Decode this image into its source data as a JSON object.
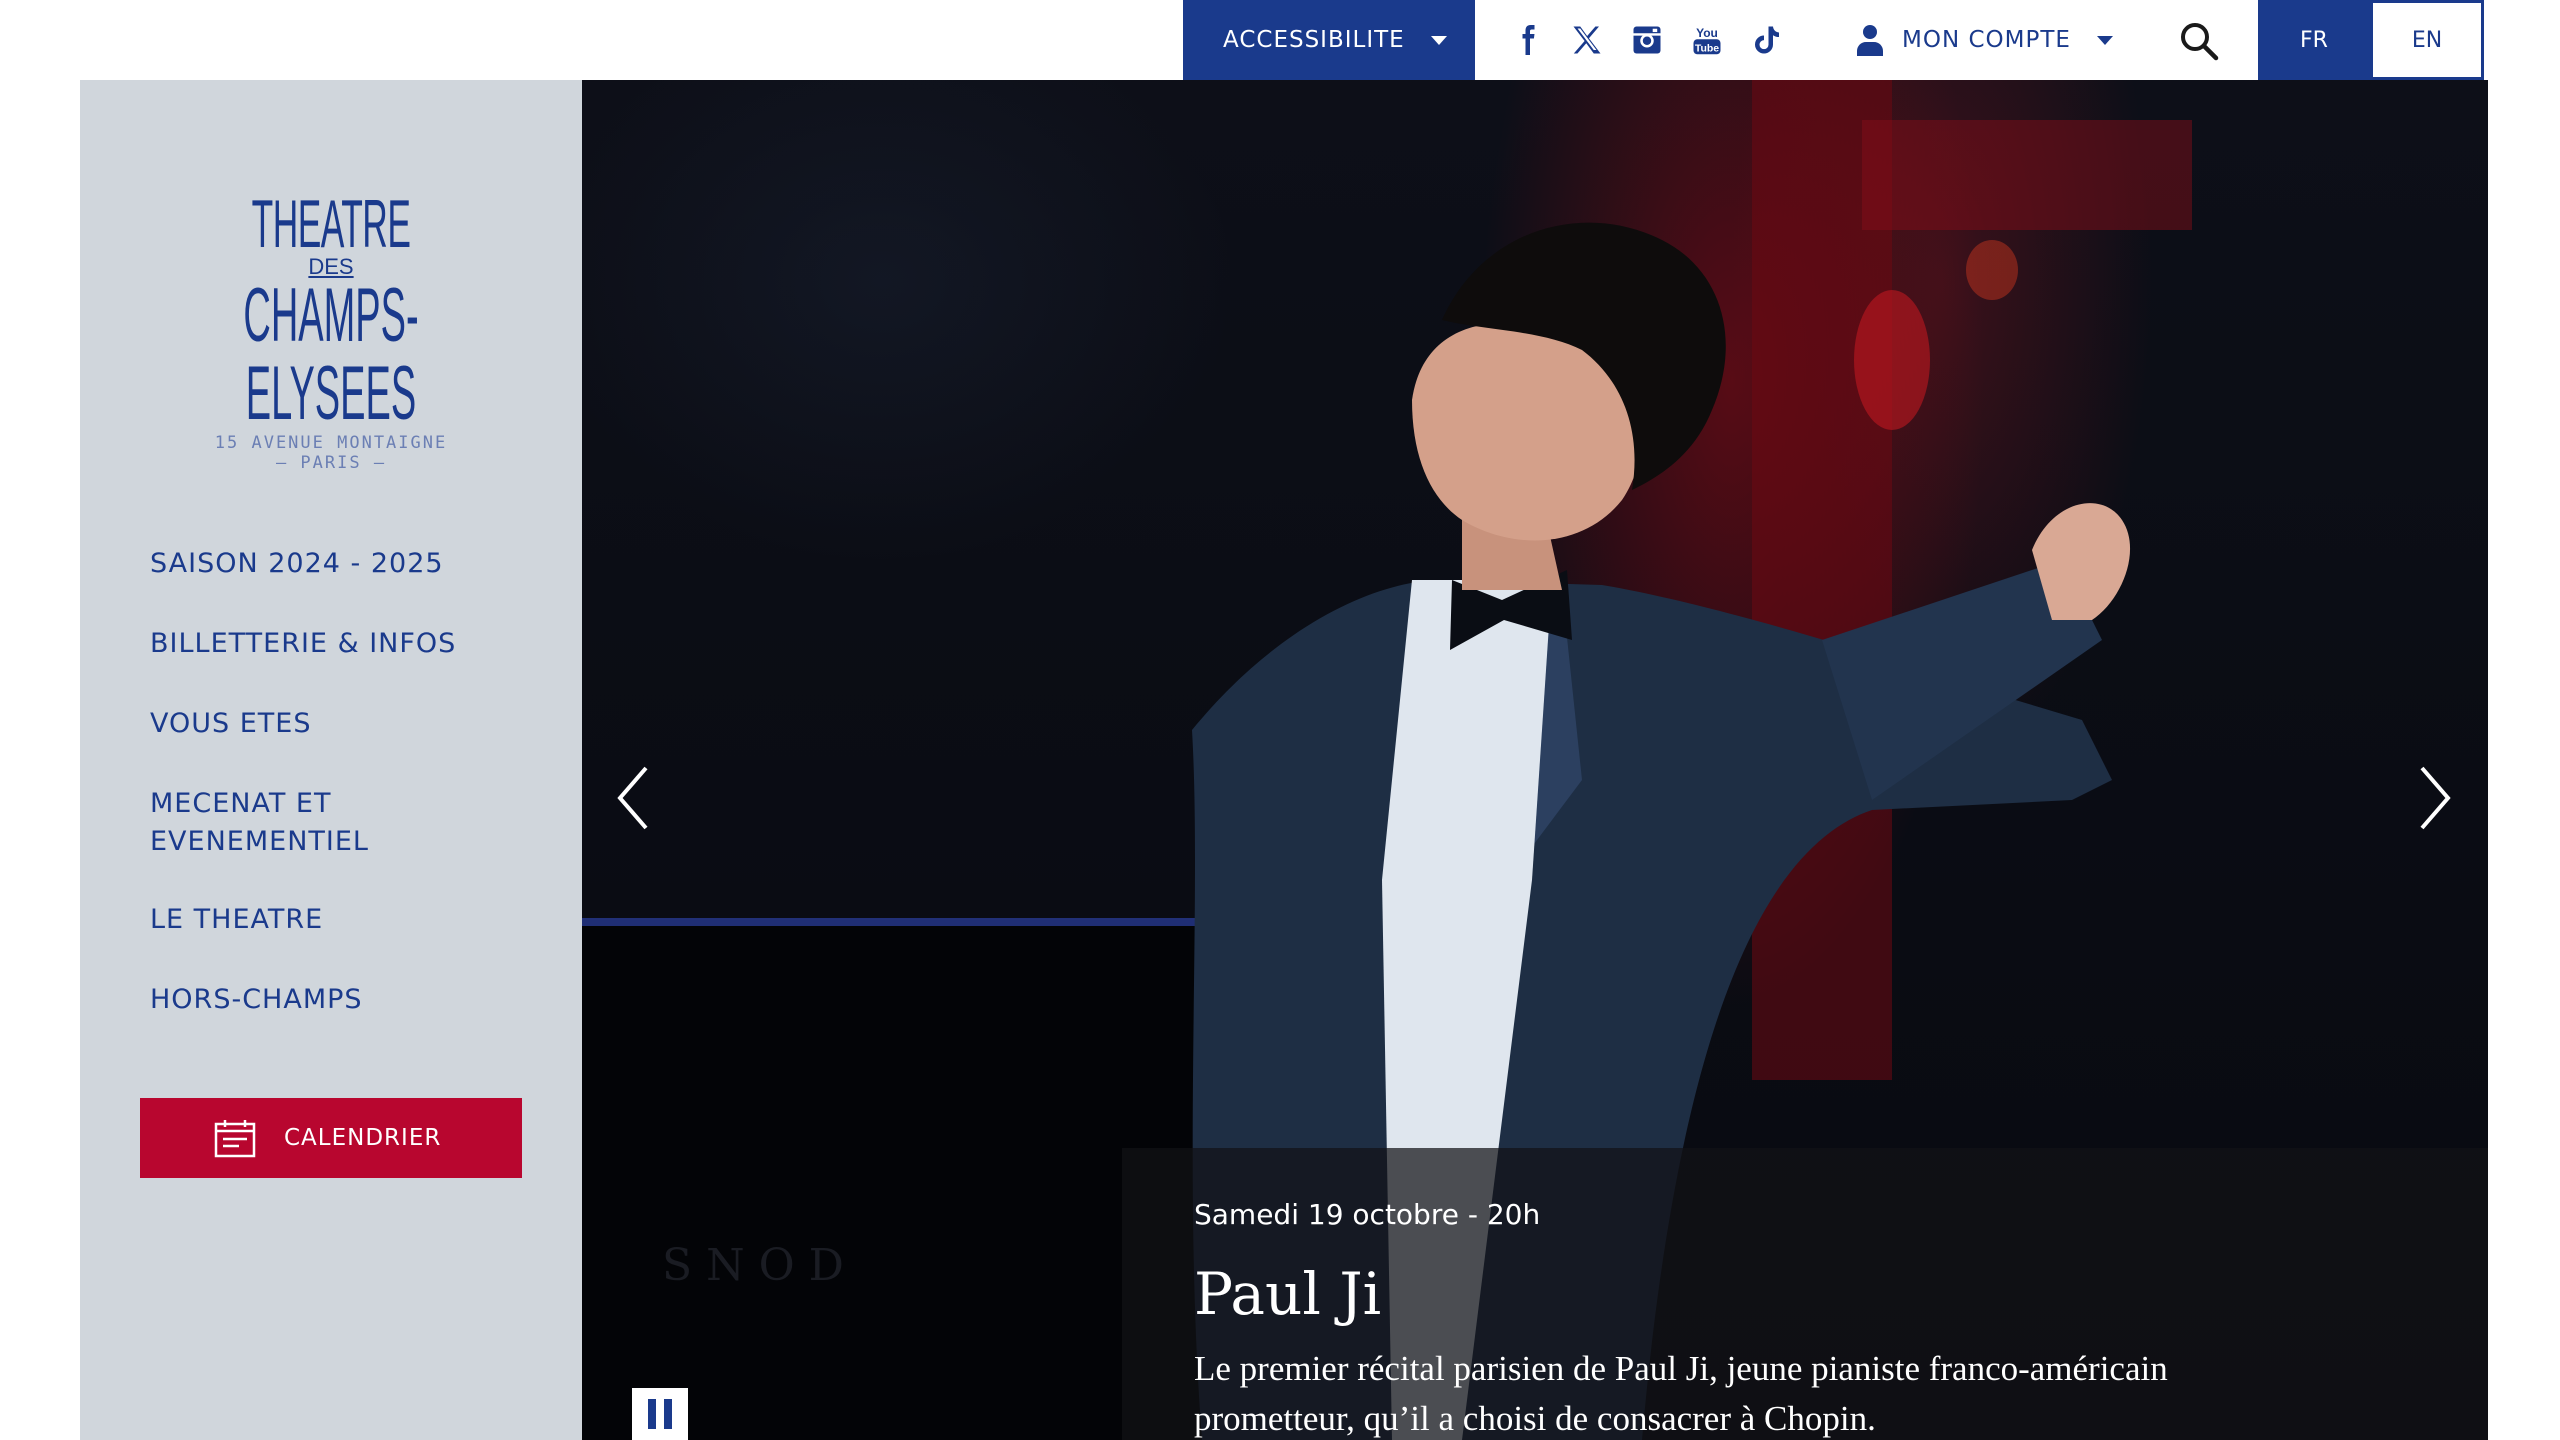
{
  "topbar": {
    "accessibility_label": "ACCESSIBILITE",
    "account_label": "MON COMPTE",
    "social_icons": [
      "facebook-icon",
      "x-icon",
      "instagram-icon",
      "youtube-icon",
      "tiktok-icon"
    ],
    "lang_fr": "FR",
    "lang_en": "EN"
  },
  "logo": {
    "line1": "THEATRE",
    "line2": "DES",
    "line3": "CHAMPS-ELYSEES",
    "line4": "15 AVENUE MONTAIGNE",
    "line5": "— PARIS —"
  },
  "sidebar": {
    "nav": [
      {
        "label": "SAISON 2024 - 2025"
      },
      {
        "label": "BILLETTERIE & INFOS"
      },
      {
        "label": "VOUS ETES"
      },
      {
        "label": "MECENAT ET EVENEMENTIEL"
      },
      {
        "label": "LE THEATRE"
      },
      {
        "label": "HORS-CHAMPS"
      }
    ],
    "calendar_label": "CALENDRIER"
  },
  "hero": {
    "date": "Samedi 19 octobre - 20h",
    "title": "Paul Ji",
    "description": "Le premier récital parisien de Paul Ji, jeune pianiste franco-américain prometteur, qu’il a choisi de consacrer à Chopin."
  },
  "colors": {
    "brand_blue": "#1a3a8c",
    "sidebar_bg": "#d0d6dc",
    "calendar_red": "#b8062f"
  }
}
